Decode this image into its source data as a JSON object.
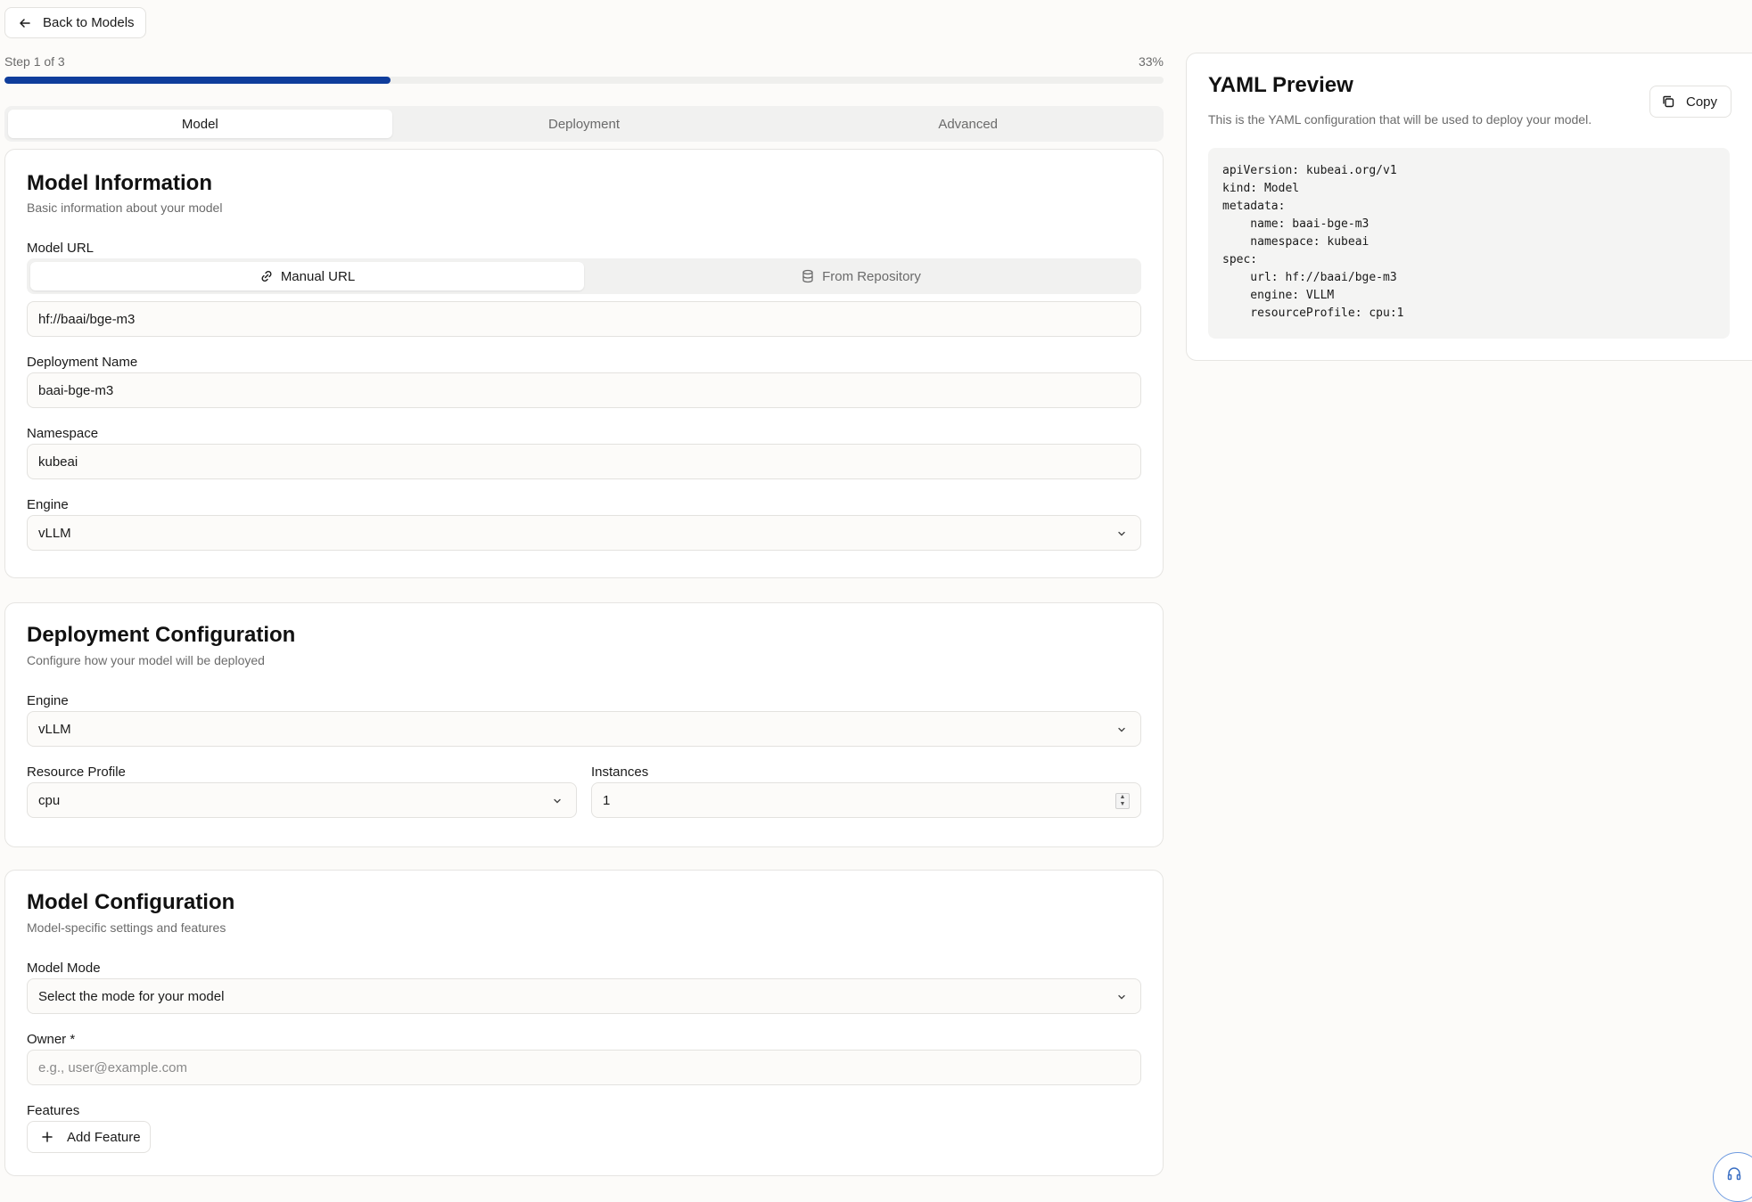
{
  "header": {
    "back_label": "Back to Models"
  },
  "progress": {
    "step_label": "Step 1 of 3",
    "percent_label": "33%",
    "fraction": 0.333
  },
  "tabs": [
    {
      "label": "Model",
      "active": true
    },
    {
      "label": "Deployment",
      "active": false
    },
    {
      "label": "Advanced",
      "active": false
    }
  ],
  "model_info": {
    "title": "Model Information",
    "subtitle": "Basic information about your model",
    "model_url_label": "Model URL",
    "url_modes": [
      {
        "label": "Manual URL",
        "icon": "link-icon"
      },
      {
        "label": "From Repository",
        "icon": "database-icon"
      }
    ],
    "model_url_value": "hf://baai/bge-m3",
    "deployment_name_label": "Deployment Name",
    "deployment_name_value": "baai-bge-m3",
    "namespace_label": "Namespace",
    "namespace_value": "kubeai",
    "engine_label": "Engine",
    "engine_value": "vLLM"
  },
  "deployment_config": {
    "title": "Deployment Configuration",
    "subtitle": "Configure how your model will be deployed",
    "engine_label": "Engine",
    "engine_value": "vLLM",
    "resource_profile_label": "Resource Profile",
    "resource_profile_value": "cpu",
    "instances_label": "Instances",
    "instances_value": "1"
  },
  "model_config": {
    "title": "Model Configuration",
    "subtitle": "Model-specific settings and features",
    "mode_label": "Model Mode",
    "mode_placeholder": "Select the mode for your model",
    "owner_label": "Owner *",
    "owner_placeholder": "e.g., user@example.com",
    "features_label": "Features",
    "add_feature_label": "Add Feature"
  },
  "yaml_preview": {
    "title": "YAML Preview",
    "subtitle": "This is the YAML configuration that will be used to deploy your model.",
    "copy_label": "Copy",
    "code": "apiVersion: kubeai.org/v1\nkind: Model\nmetadata:\n    name: baai-bge-m3\n    namespace: kubeai\nspec:\n    url: hf://baai/bge-m3\n    engine: VLLM\n    resourceProfile: cpu:1"
  },
  "colors": {
    "accent": "#0f3d9c",
    "background": "#fcfbf9"
  }
}
